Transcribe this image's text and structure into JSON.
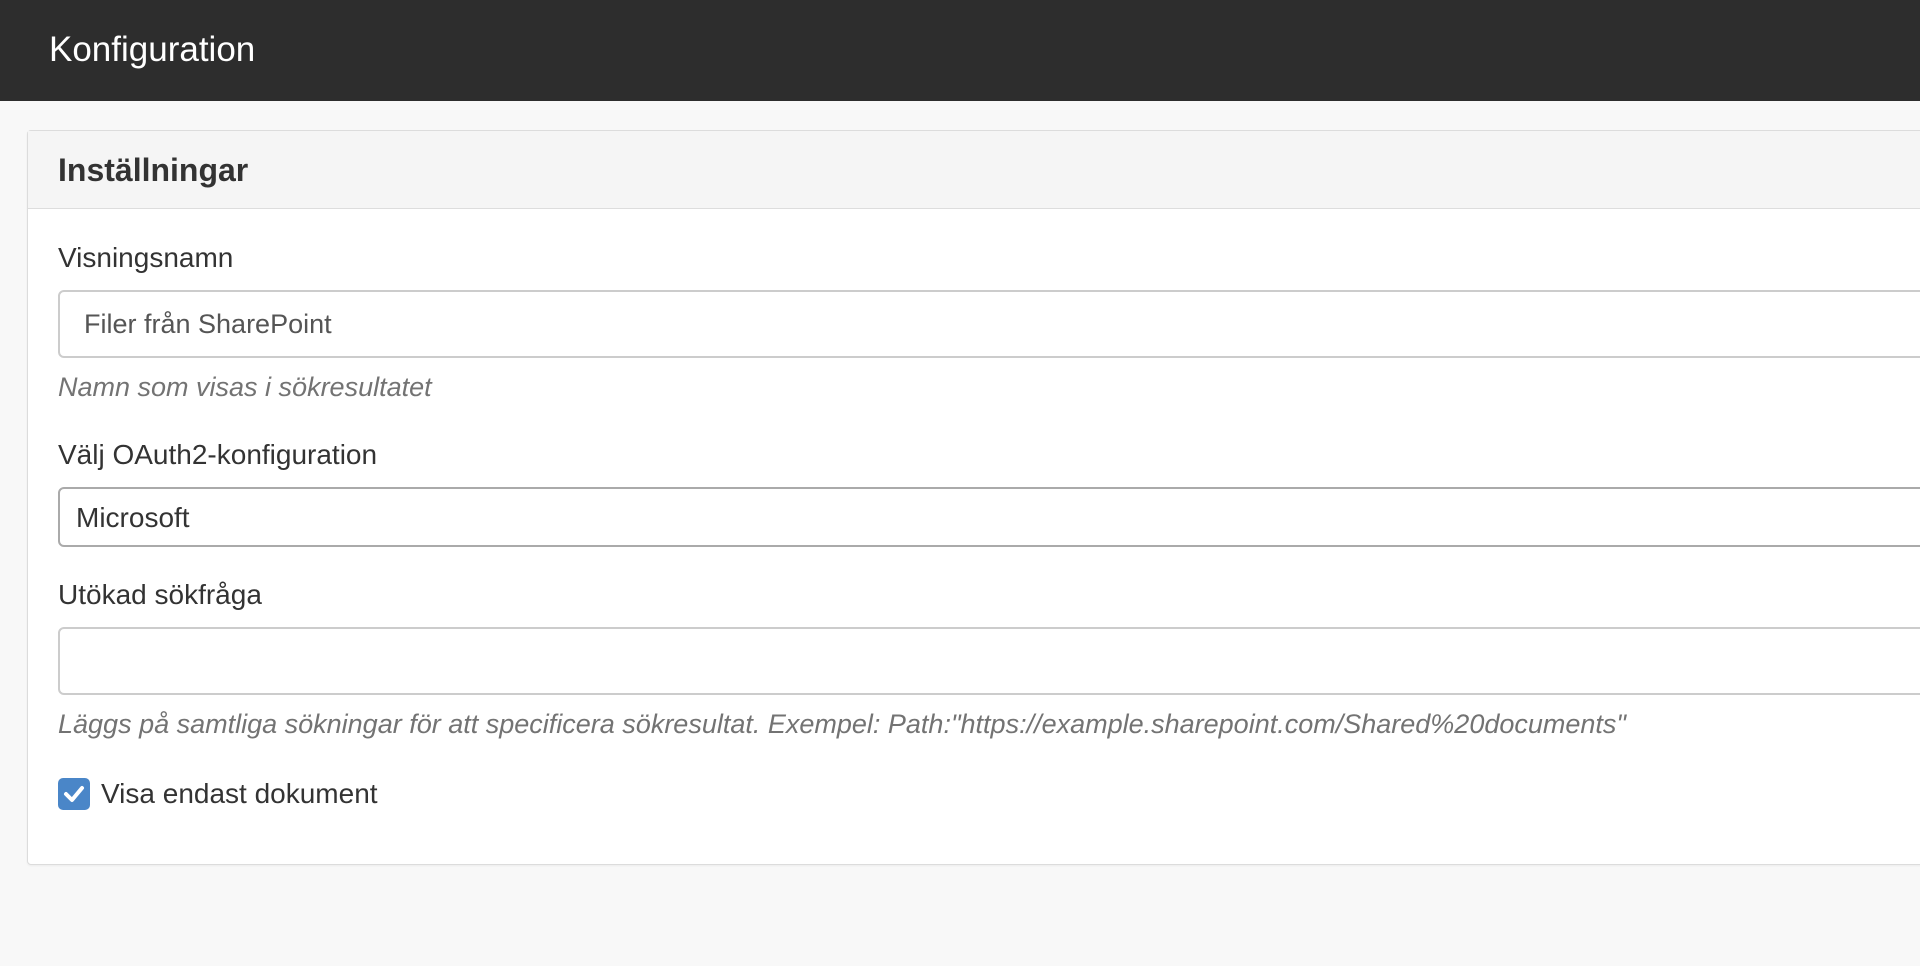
{
  "header": {
    "title": "Konfiguration"
  },
  "panel": {
    "title": "Inställningar"
  },
  "form": {
    "display_name": {
      "label": "Visningsnamn",
      "value": "Filer från SharePoint",
      "help": "Namn som visas i sökresultatet"
    },
    "oauth2": {
      "label": "Välj OAuth2-konfiguration",
      "selected": "Microsoft"
    },
    "extended_query": {
      "label": "Utökad sökfråga",
      "value": "",
      "help": "Läggs på samtliga sökningar för att specificera sökresultat. Exempel: Path:\"https://example.sharepoint.com/Shared%20documents\""
    },
    "documents_only": {
      "label": "Visa endast dokument",
      "checked": true
    }
  },
  "colors": {
    "topbar": "#2d2d2d",
    "checkbox": "#4a86c8"
  }
}
